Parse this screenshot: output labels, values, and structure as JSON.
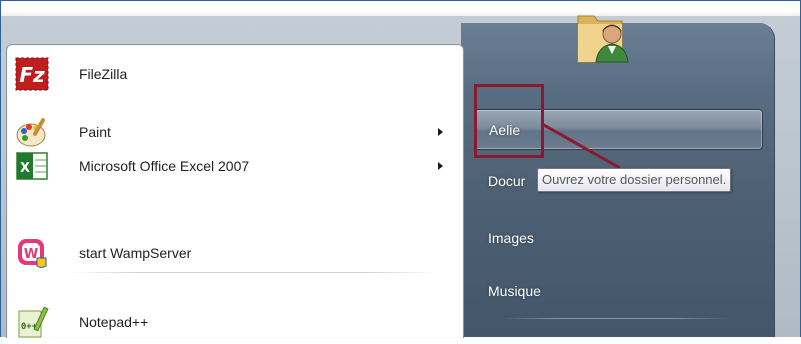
{
  "start_menu": {
    "programs": [
      {
        "label": "FileZilla",
        "icon": "filezilla-icon",
        "has_submenu": false
      },
      {
        "label": "Paint",
        "icon": "paint-icon",
        "has_submenu": true
      },
      {
        "label": "Microsoft Office Excel 2007",
        "icon": "excel-icon",
        "has_submenu": true
      },
      {
        "label": "start WampServer",
        "icon": "wampserver-icon",
        "has_submenu": false
      },
      {
        "label": "Notepad++",
        "icon": "notepad-plus-plus-icon",
        "has_submenu": false
      }
    ],
    "user_picture": "user-folder-icon",
    "places": [
      {
        "label": "Aelie",
        "state": "hover"
      },
      {
        "label": "Docur",
        "state": "normal"
      },
      {
        "label": "Images",
        "state": "normal"
      },
      {
        "label": "Musique",
        "state": "normal"
      }
    ],
    "tooltip": "Ouvrez votre dossier personnel."
  },
  "colors": {
    "annotation": "#8b1a2f",
    "right_pane": "#4d6074",
    "frame_border": "#2f5f9a"
  }
}
